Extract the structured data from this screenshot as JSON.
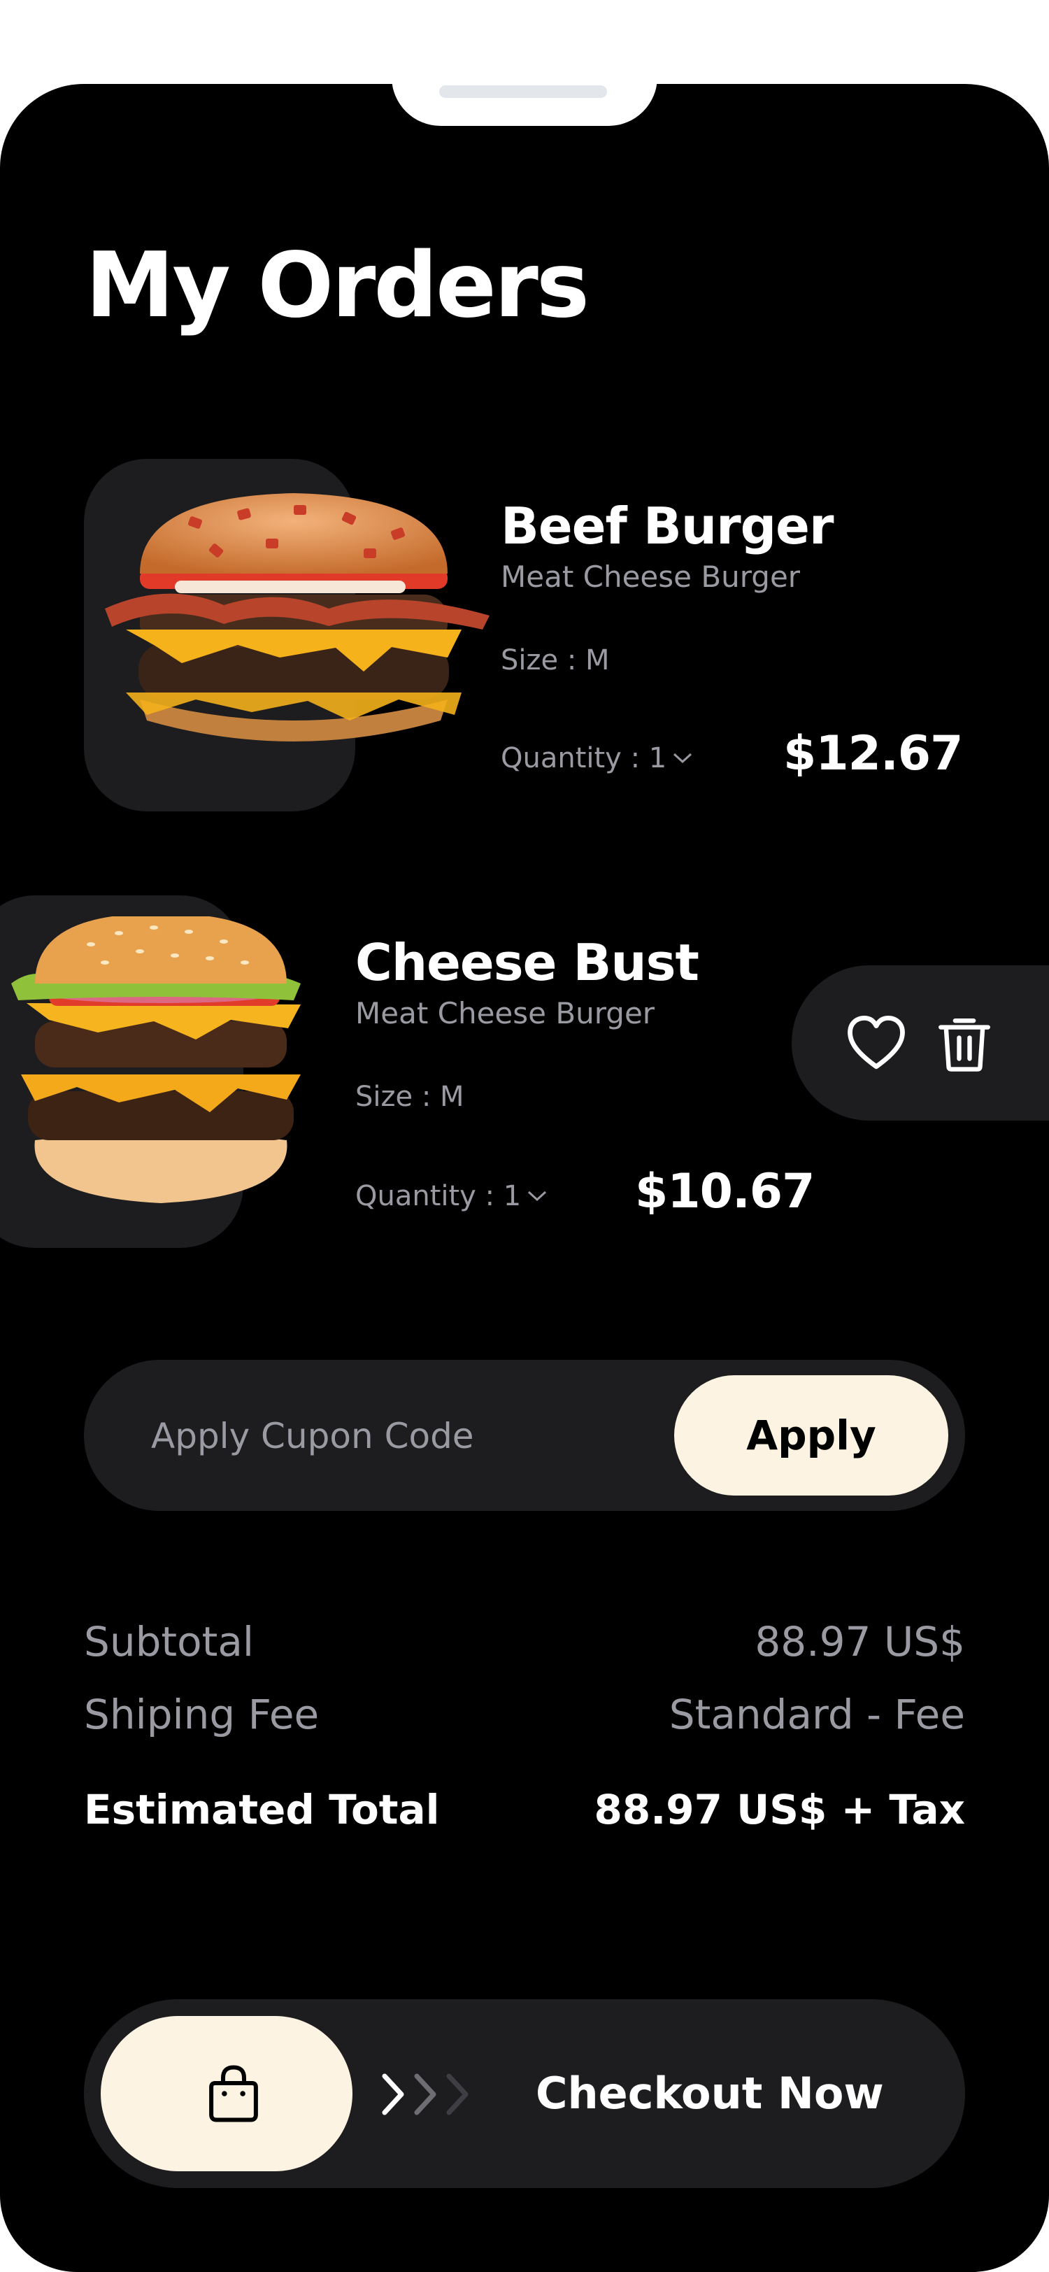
{
  "page": {
    "title": "My Orders"
  },
  "orders": [
    {
      "name": "Beef Burger",
      "description": "Meat Cheese Burger",
      "size": "Size : M",
      "quantity": "Quantity : 1",
      "price": "$12.67"
    },
    {
      "name": "Cheese Bust",
      "description": "Meat Cheese Burger",
      "size": "Size : M",
      "quantity": "Quantity : 1",
      "price": "$10.67"
    }
  ],
  "row_actions": [
    "heart-icon",
    "trash-icon"
  ],
  "coupon": {
    "placeholder": "Apply Cupon Code",
    "button_label": "Apply"
  },
  "summary": {
    "subtotal_label": "Subtotal",
    "subtotal_value": "88.97 US$",
    "shipping_label": "Shiping Fee",
    "shipping_value": "Standard - Fee",
    "total_label": "Estimated Total",
    "total_value": "88.97 US$ + Tax"
  },
  "checkout": {
    "label": "Checkout Now",
    "icon": "shopping-bag-icon"
  },
  "colors": {
    "background": "#000000",
    "card": "#1d1d20",
    "accent": "#fdf3e2",
    "muted_text": "#9a9aa3",
    "text": "#ffffff"
  }
}
